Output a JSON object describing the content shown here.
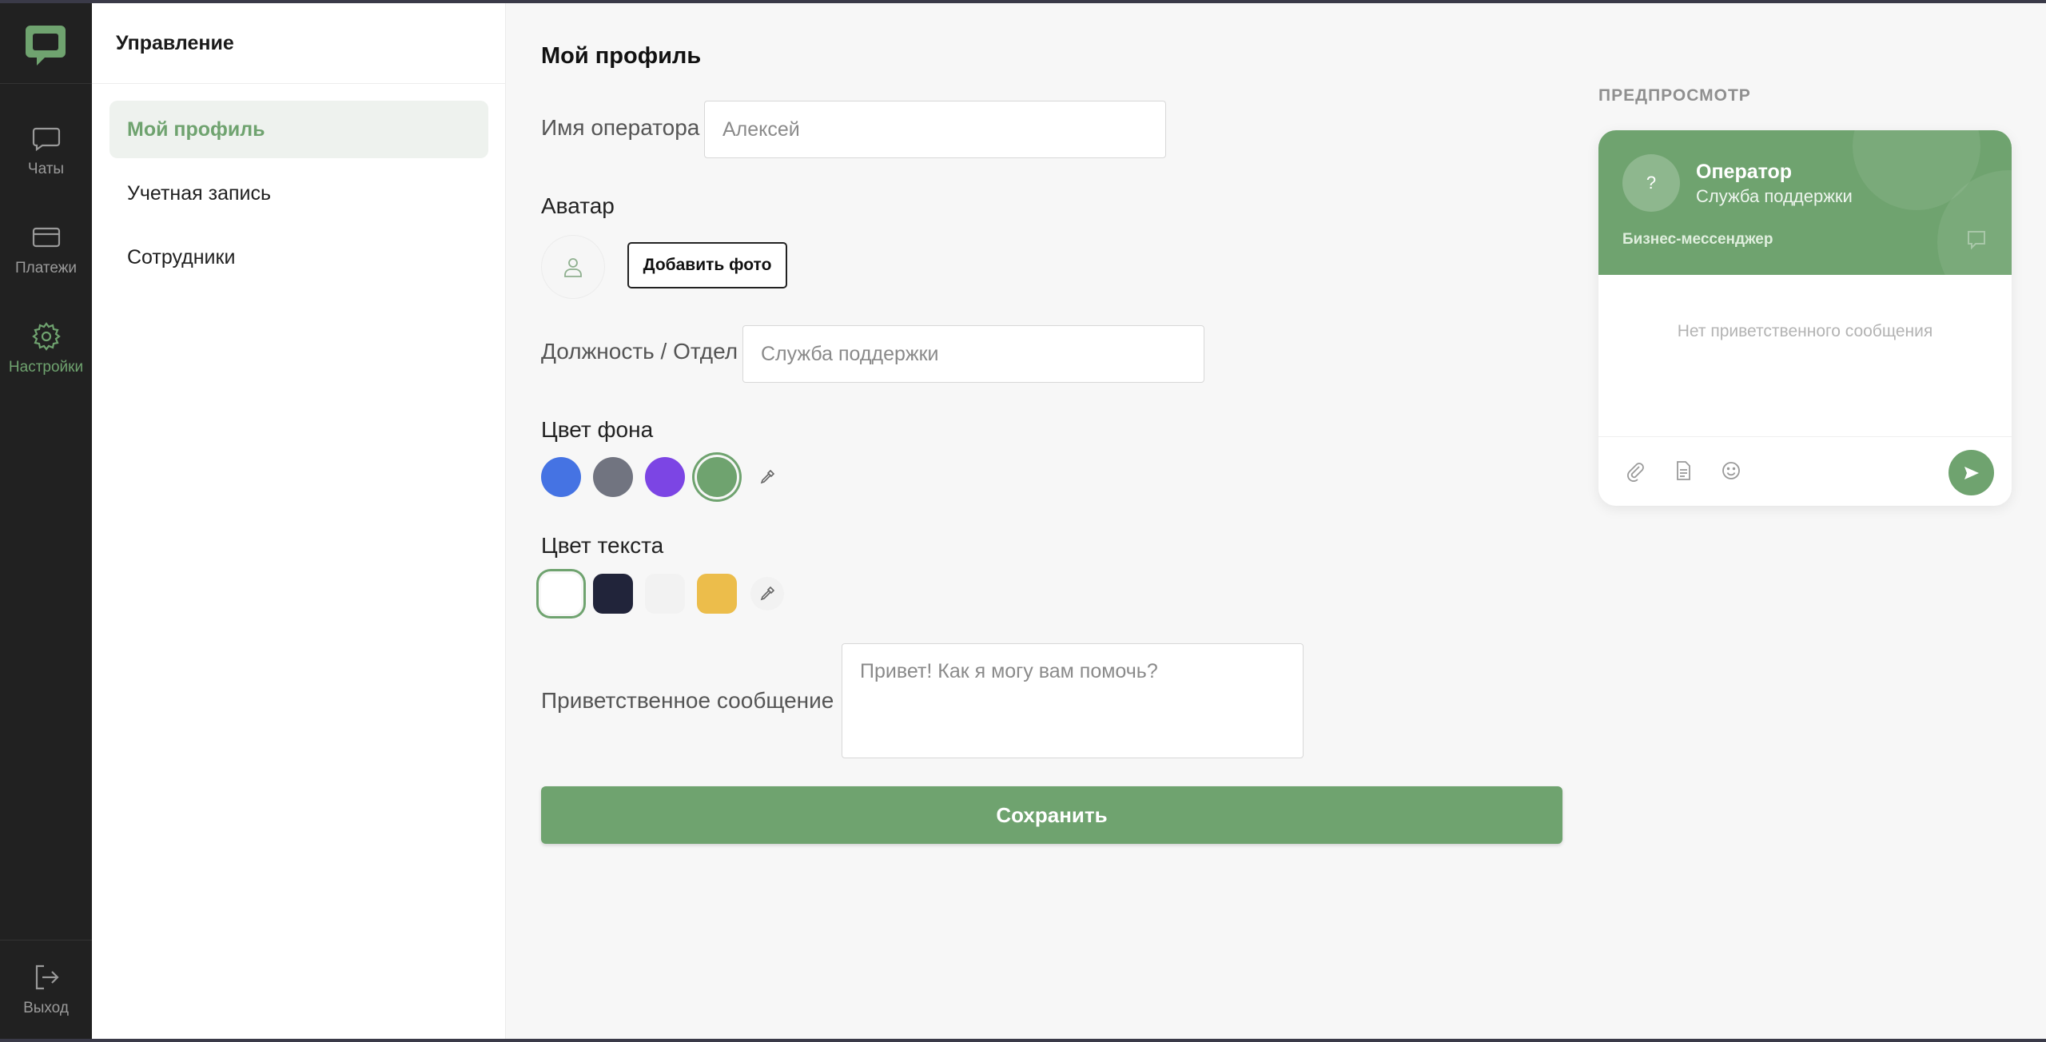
{
  "app": {
    "logo_icon": "chat-bubble-logo-icon"
  },
  "rail": {
    "items": [
      {
        "label": "Чаты",
        "icon": "chat-icon"
      },
      {
        "label": "Платежи",
        "icon": "card-icon"
      },
      {
        "label": "Настройки",
        "icon": "gear-icon",
        "active": true
      }
    ],
    "logout": {
      "label": "Выход",
      "icon": "logout-icon"
    }
  },
  "subnav": {
    "heading": "Управление",
    "items": [
      {
        "label": "Мой профиль",
        "active": true
      },
      {
        "label": "Учетная запись"
      },
      {
        "label": "Сотрудники"
      }
    ]
  },
  "form": {
    "title": "Мой профиль",
    "operator_name": {
      "label": "Имя оператора",
      "placeholder": "Алексей",
      "value": ""
    },
    "avatar": {
      "label": "Аватар",
      "button": "Добавить фото",
      "icon": "user-icon"
    },
    "position": {
      "label": "Должность / Отдел",
      "placeholder": "Служба поддержки",
      "value": ""
    },
    "bg_color": {
      "label": "Цвет фона",
      "swatches": [
        "#4573e3",
        "#717480",
        "#7c45e4",
        "#6fa36f"
      ],
      "selected": "#6fa36f",
      "picker_icon": "eyedropper-icon"
    },
    "text_color": {
      "label": "Цвет текста",
      "swatches": [
        "#ffffff",
        "#21243a",
        "#f2f2f2",
        "#ecbd4b"
      ],
      "selected": "#ffffff",
      "picker_icon": "eyedropper-icon"
    },
    "greeting": {
      "label": "Приветственное сообщение",
      "placeholder": "Привет! Как я могу вам помочь?",
      "value": ""
    },
    "save": "Сохранить"
  },
  "preview": {
    "label": "ПРЕДПРОСМОТР",
    "avatar_placeholder": "?",
    "name": "Оператор",
    "role": "Служба поддержки",
    "brand": "Бизнес-мессенджер",
    "empty": "Нет приветственного сообщения",
    "tools": [
      "paperclip-icon",
      "document-icon",
      "smiley-icon"
    ],
    "send_icon": "send-icon",
    "accent": "#6fa36f"
  }
}
